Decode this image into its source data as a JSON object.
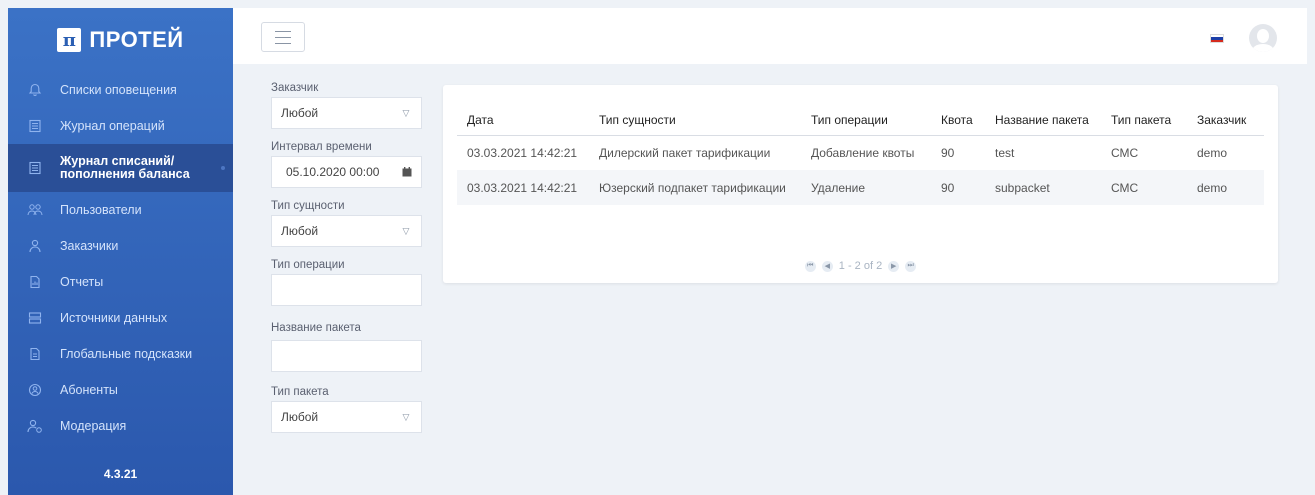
{
  "brand": {
    "logo_mark": "π",
    "name": "ПРОТЕЙ"
  },
  "version": "4.3.21",
  "sidebar": {
    "items": [
      {
        "label": "Списки оповещения",
        "icon": "bell-icon"
      },
      {
        "label": "Журнал операций",
        "icon": "document-icon"
      },
      {
        "label": "Журнал списаний/\nпополнения баланса",
        "icon": "document-icon",
        "active": true
      },
      {
        "label": "Пользователи",
        "icon": "users-icon"
      },
      {
        "label": "Заказчики",
        "icon": "customer-icon"
      },
      {
        "label": "Отчеты",
        "icon": "report-icon"
      },
      {
        "label": "Источники данных",
        "icon": "database-icon"
      },
      {
        "label": "Глобальные подсказки",
        "icon": "hint-icon"
      },
      {
        "label": "Абоненты",
        "icon": "subscriber-icon"
      },
      {
        "label": "Модерация",
        "icon": "moderation-icon"
      }
    ]
  },
  "topbar": {
    "flag": "ru-flag-icon",
    "avatar": "avatar-icon"
  },
  "filters": {
    "customer": {
      "label": "Заказчик",
      "value": "Любой"
    },
    "interval": {
      "label": "Интервал времени",
      "value": "05.10.2020 00:00"
    },
    "entity_type": {
      "label": "Тип сущности",
      "value": "Любой"
    },
    "operation_type": {
      "label": "Тип операции",
      "value": ""
    },
    "package_name": {
      "label": "Название пакета",
      "value": ""
    },
    "package_type": {
      "label": "Тип пакета",
      "value": "Любой"
    }
  },
  "table": {
    "headers": [
      "Дата",
      "Тип сущности",
      "Тип операции",
      "Квота",
      "Название пакета",
      "Тип пакета",
      "Заказчик"
    ],
    "rows": [
      [
        "03.03.2021 14:42:21",
        "Дилерский пакет тарификации",
        "Добавление квоты",
        "90",
        "test",
        "СМС",
        "demo"
      ],
      [
        "03.03.2021 14:42:21",
        "Юзерский подпакет тарификации",
        "Удаление",
        "90",
        "subpacket",
        "СМС",
        "demo"
      ]
    ]
  },
  "pager": {
    "text": "1 - 2 of 2"
  },
  "colors": {
    "sidebar_top": "#3b72c6",
    "sidebar_bottom": "#2b58ad",
    "background": "#eef2f7"
  }
}
